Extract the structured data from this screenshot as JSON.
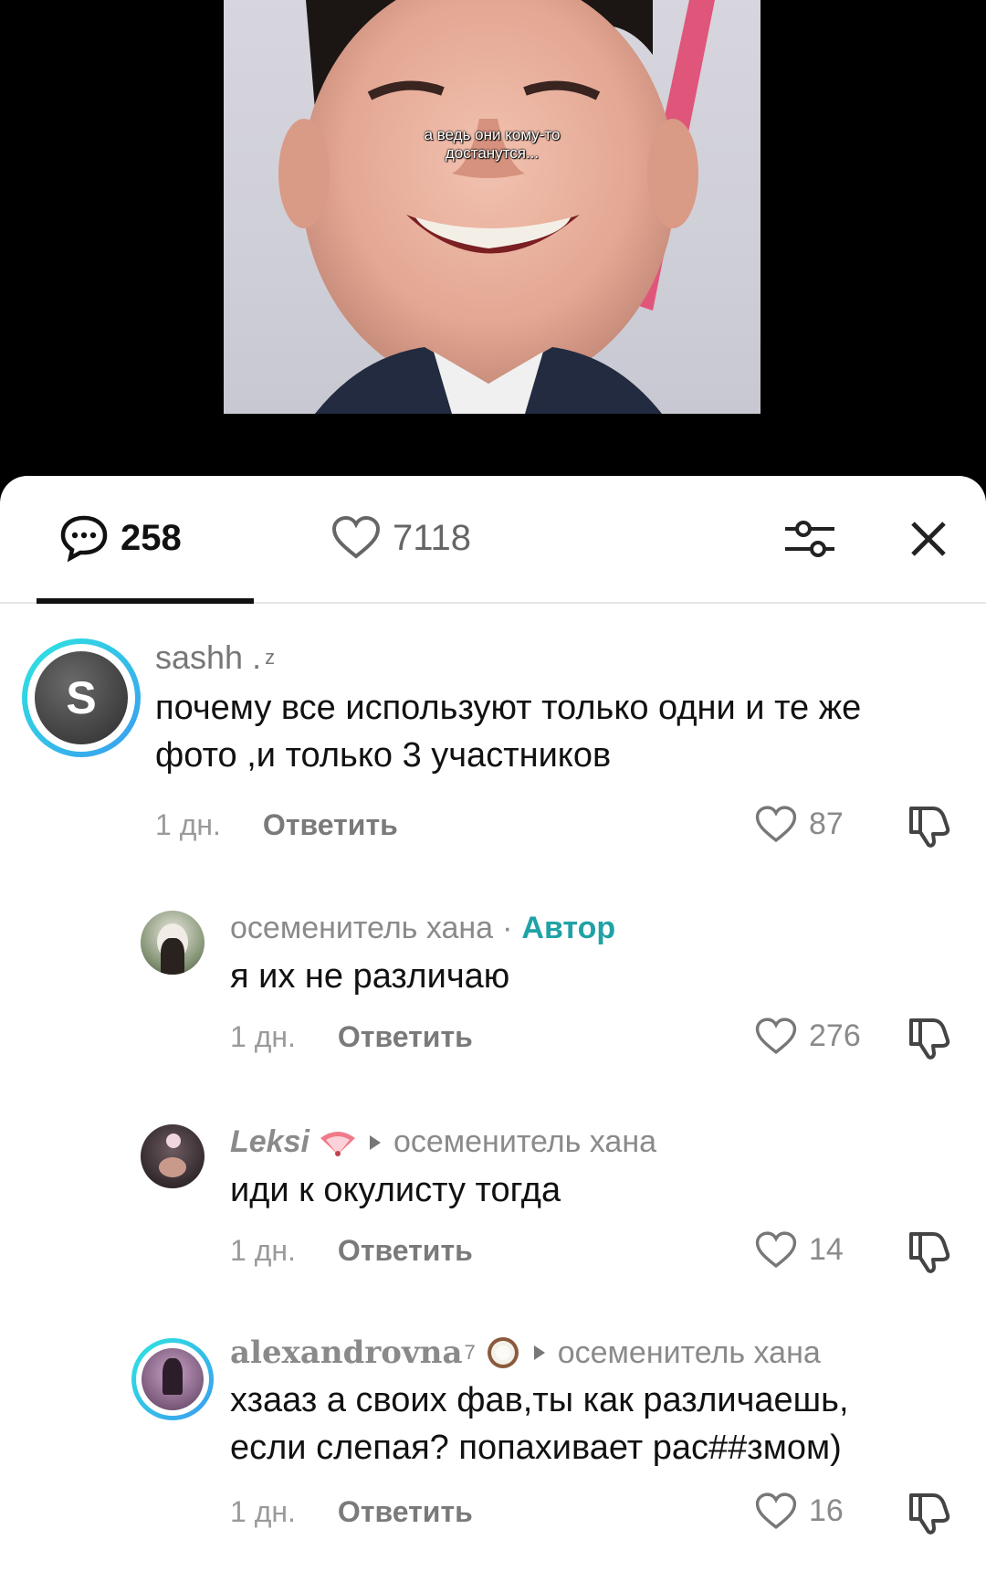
{
  "video": {
    "caption_line1": "а ведь они кому-то",
    "caption_line2": "достанутся..."
  },
  "tabs": {
    "comments_count": "258",
    "likes_count": "7118"
  },
  "comments": [
    {
      "username": "sashh .",
      "username_suffix": "z",
      "avatar_letter": "S",
      "text": "почему все используют только одни и те же фото ,и только 3 участников",
      "time": "1 дн.",
      "reply_label": "Ответить",
      "likes": "87"
    },
    {
      "username": "осеменитель хана",
      "separator": "·",
      "author_label": "Автор",
      "text": "я их не различаю",
      "time": "1 дн.",
      "reply_label": "Ответить",
      "likes": "276"
    },
    {
      "username": "Leksi",
      "reply_to": "осеменитель хана",
      "text": "иди к окулисту тогда",
      "time": "1 дн.",
      "reply_label": "Ответить",
      "likes": "14"
    },
    {
      "username": "alexandrovna",
      "username_suffix": "7",
      "reply_to": "осеменитель хана",
      "text_line1": "хзааз а своих фав,ты как различаешь,",
      "text_line2": "если слепая? попахивает рас##змом)",
      "time": "1 дн.",
      "reply_label": "Ответить",
      "likes": "16"
    }
  ],
  "colors": {
    "accent_teal": "#20a2a6",
    "ring_gradient_start": "#2ee6e0",
    "ring_gradient_end": "#3a9bf0"
  }
}
